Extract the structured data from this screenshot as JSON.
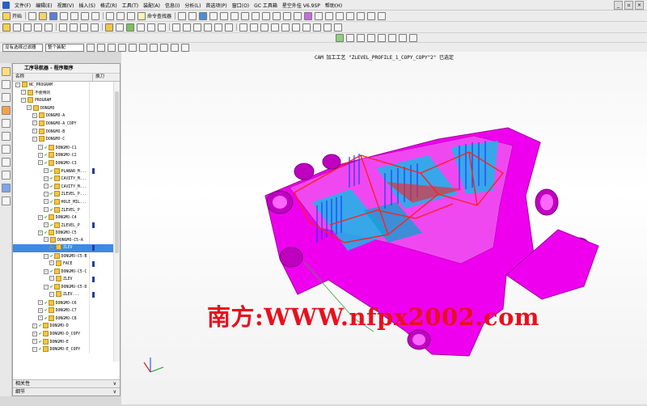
{
  "menubar": {
    "items": [
      "文件(F)",
      "编辑(E)",
      "视图(V)",
      "插入(S)",
      "格式(R)",
      "工具(T)",
      "装配(A)",
      "信息(I)",
      "分析(L)",
      "首选项(P)",
      "窗口(O)",
      "GC 工具箱",
      "星空外挂 V6.9SP",
      "帮助(H)"
    ]
  },
  "toolbar1": {
    "start_label": "开始",
    "command_finder_label": "命令查找器"
  },
  "selection": {
    "filter_value": "没有选择过滤器",
    "scope_value": "整个装配"
  },
  "viewport": {
    "status_text": "CAM 加工工艺 \"ZLEVEL_PROFILE_1_COPY_COPY\"2\" 已选定",
    "watermark": "南方:WWW.nfpx2002.com",
    "colors": {
      "part": "#ee00ee",
      "toolpath": "#ff2020",
      "engage": "#1e3cff",
      "face": "#00c8ff"
    }
  },
  "navigator": {
    "title": "工序导航器 - 程序顺序",
    "col_name": "名称",
    "col_tool": "换刀",
    "rows": [
      {
        "indent": 0,
        "label": "NC_PROGRAM",
        "chk": false,
        "tool": false,
        "sel": false
      },
      {
        "indent": 1,
        "label": "不使用的",
        "chk": false,
        "tool": false,
        "sel": false
      },
      {
        "indent": 1,
        "label": "PROGRAM",
        "chk": false,
        "tool": false,
        "sel": false
      },
      {
        "indent": 2,
        "label": "DONGMO",
        "chk": false,
        "tool": false,
        "sel": false
      },
      {
        "indent": 3,
        "label": "DONGMO-A",
        "chk": false,
        "tool": false,
        "sel": false
      },
      {
        "indent": 3,
        "label": "DONGMO-A_COPY",
        "chk": false,
        "tool": false,
        "sel": false
      },
      {
        "indent": 3,
        "label": "DONGMO-B",
        "chk": false,
        "tool": false,
        "sel": false
      },
      {
        "indent": 3,
        "label": "DONGMO-C",
        "chk": false,
        "tool": false,
        "sel": false
      },
      {
        "indent": 4,
        "label": "DONGMO-C1",
        "chk": true,
        "tool": false,
        "sel": false
      },
      {
        "indent": 4,
        "label": "DONGMO-C2",
        "chk": true,
        "tool": false,
        "sel": false
      },
      {
        "indent": 4,
        "label": "DONGMO-C3",
        "chk": true,
        "tool": false,
        "sel": false
      },
      {
        "indent": 5,
        "label": "PLANAR_M...",
        "chk": true,
        "tool": true,
        "sel": false
      },
      {
        "indent": 5,
        "label": "CAVITY_M...",
        "chk": true,
        "tool": false,
        "sel": false
      },
      {
        "indent": 5,
        "label": "CAVITY_M...",
        "chk": true,
        "tool": false,
        "sel": false
      },
      {
        "indent": 5,
        "label": "ZLEVEL_P...",
        "chk": true,
        "tool": false,
        "sel": false
      },
      {
        "indent": 5,
        "label": "HOLE_MIL...",
        "chk": true,
        "tool": false,
        "sel": false
      },
      {
        "indent": 5,
        "label": "ZLEVEL_P",
        "chk": true,
        "tool": false,
        "sel": false
      },
      {
        "indent": 4,
        "label": "DONGMO-C4",
        "chk": true,
        "tool": false,
        "sel": false
      },
      {
        "indent": 5,
        "label": "ZLEVEL_P",
        "chk": true,
        "tool": true,
        "sel": false
      },
      {
        "indent": 4,
        "label": "DONGMO-C5",
        "chk": true,
        "tool": false,
        "sel": false
      },
      {
        "indent": 5,
        "label": "DONGMO-C5-A",
        "chk": false,
        "tool": false,
        "sel": false
      },
      {
        "indent": 6,
        "label": "ZLEV",
        "chk": false,
        "tool": true,
        "sel": true
      },
      {
        "indent": 5,
        "label": "DONGMO-C5-B",
        "chk": true,
        "tool": false,
        "sel": false
      },
      {
        "indent": 6,
        "label": "FACE",
        "chk": false,
        "tool": true,
        "sel": false
      },
      {
        "indent": 5,
        "label": "DONGMO-C5-C",
        "chk": true,
        "tool": false,
        "sel": false
      },
      {
        "indent": 6,
        "label": "ZLEV",
        "chk": false,
        "tool": true,
        "sel": false
      },
      {
        "indent": 5,
        "label": "DONGMO-C5-D",
        "chk": true,
        "tool": false,
        "sel": false
      },
      {
        "indent": 6,
        "label": "ZLEV...",
        "chk": false,
        "tool": true,
        "sel": false
      },
      {
        "indent": 4,
        "label": "DONGMO-C6",
        "chk": true,
        "tool": false,
        "sel": false
      },
      {
        "indent": 4,
        "label": "DONGMO-C7",
        "chk": true,
        "tool": false,
        "sel": false
      },
      {
        "indent": 4,
        "label": "DONGMO-C8",
        "chk": true,
        "tool": false,
        "sel": false
      },
      {
        "indent": 3,
        "label": "DONGMO-D",
        "chk": true,
        "tool": false,
        "sel": false
      },
      {
        "indent": 3,
        "label": "DONGMO-D_COPY",
        "chk": true,
        "tool": false,
        "sel": false
      },
      {
        "indent": 3,
        "label": "DONGMO-E",
        "chk": true,
        "tool": false,
        "sel": false
      },
      {
        "indent": 3,
        "label": "DONGMO-E_COPY",
        "chk": true,
        "tool": false,
        "sel": false
      }
    ],
    "dependencies_label": "相关性",
    "details_label": "细节"
  }
}
